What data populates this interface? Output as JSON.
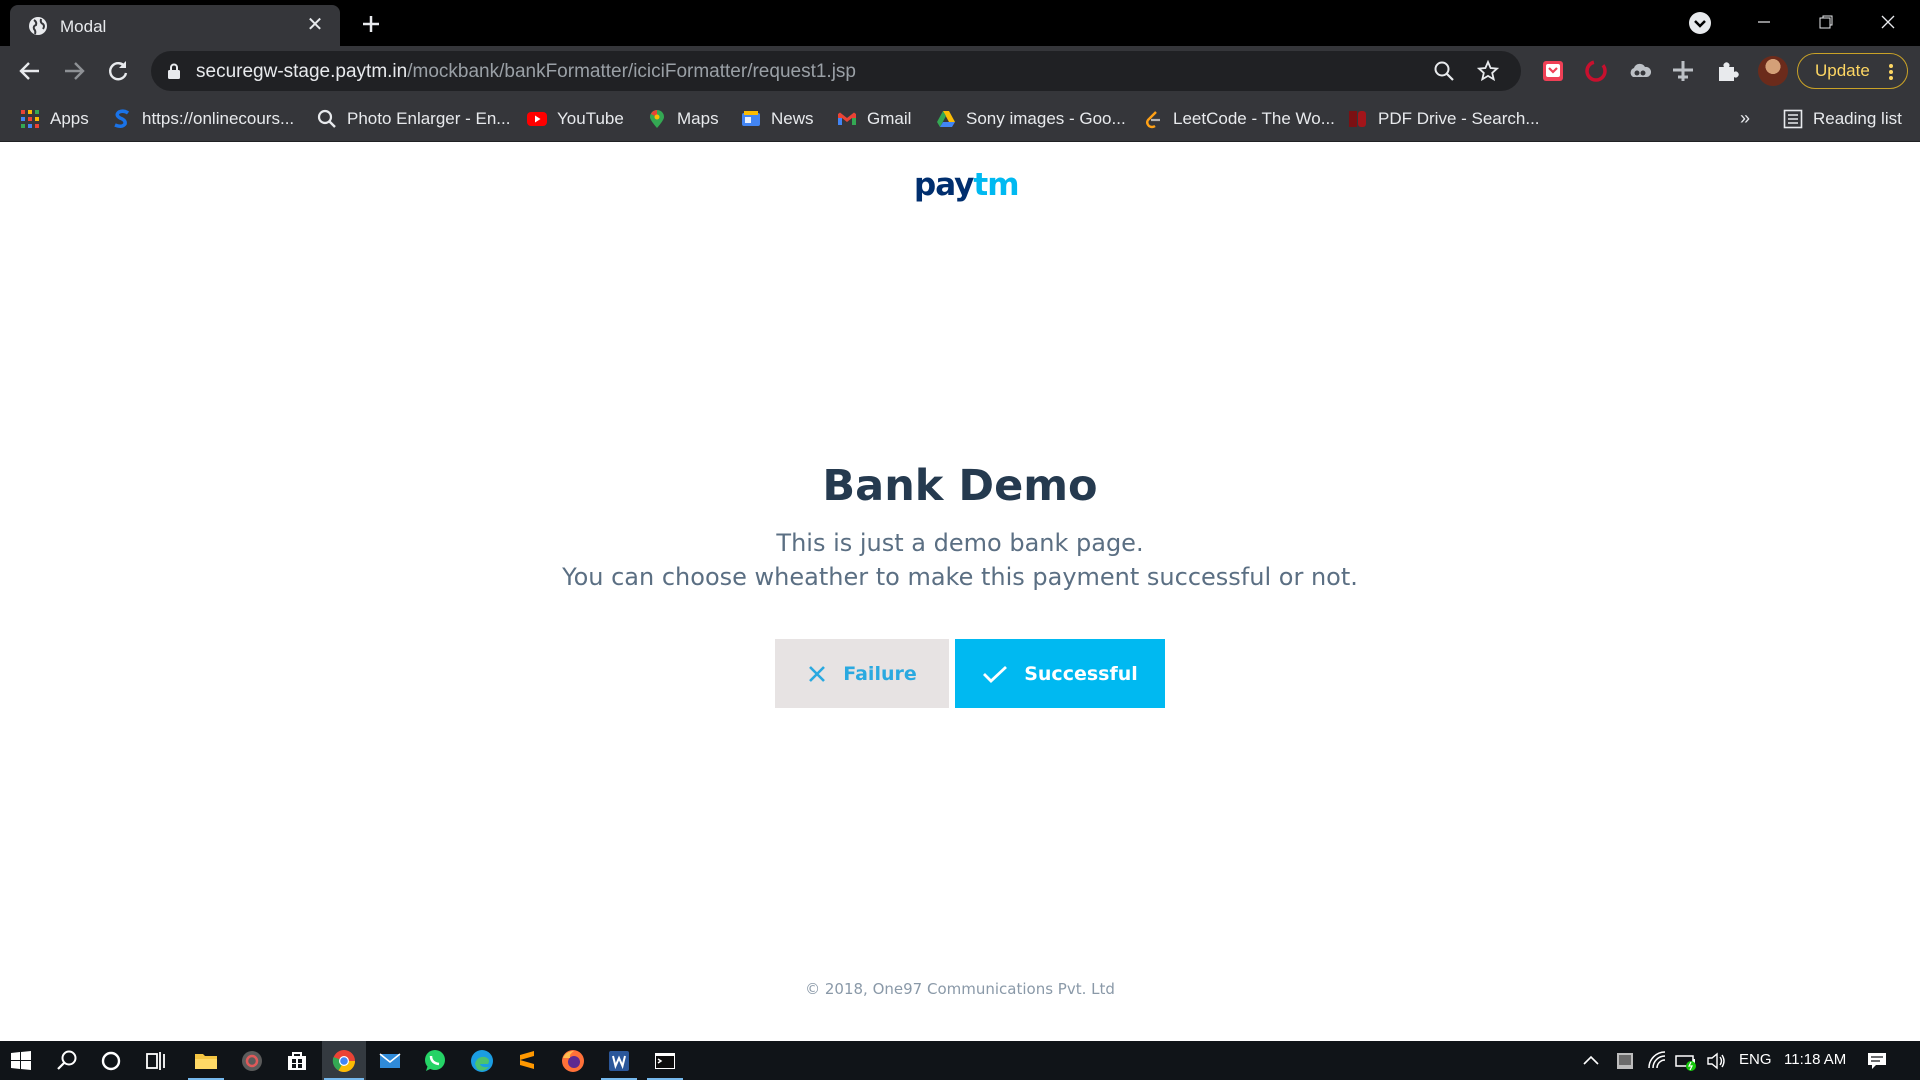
{
  "browser": {
    "tab": {
      "title": "Modal",
      "favicon": "globe-icon"
    },
    "address": {
      "host": "securegw-stage.paytm.in",
      "path": "/mockbank/bankFormatter/iciciFormatter/request1.jsp"
    },
    "update_label": "Update",
    "bookmarks": [
      {
        "label": "Apps",
        "icon": "apps-grid-icon"
      },
      {
        "label": "https://onlinecours...",
        "icon": "s-logo-icon"
      },
      {
        "label": "Photo Enlarger - En...",
        "icon": "magnifier-icon"
      },
      {
        "label": "YouTube",
        "icon": "youtube-icon"
      },
      {
        "label": "Maps",
        "icon": "maps-pin-icon"
      },
      {
        "label": "News",
        "icon": "news-icon"
      },
      {
        "label": "Gmail",
        "icon": "gmail-icon"
      },
      {
        "label": "Sony images - Goo...",
        "icon": "drive-icon"
      },
      {
        "label": "LeetCode - The Wo...",
        "icon": "leetcode-icon"
      },
      {
        "label": "PDF Drive - Search...",
        "icon": "pdf-drive-icon"
      }
    ],
    "overflow_label": "»",
    "reading_list_label": "Reading list"
  },
  "page": {
    "logo": {
      "pay": "pay",
      "tm": "tm"
    },
    "heading": "Bank Demo",
    "description": [
      "This is just a demo bank page.",
      "You can choose wheather to make this payment successful or not."
    ],
    "buttons": {
      "failure": "Failure",
      "successful": "Successful"
    },
    "footer": "© 2018, One97 Communications Pvt. Ltd"
  },
  "taskbar": {
    "language": "ENG",
    "time": "11:18 AM"
  },
  "colors": {
    "paytm_navy": "#002e6e",
    "paytm_cyan": "#00b9f1",
    "heading": "#253a4f",
    "failure_bg": "#e7e3e3"
  }
}
